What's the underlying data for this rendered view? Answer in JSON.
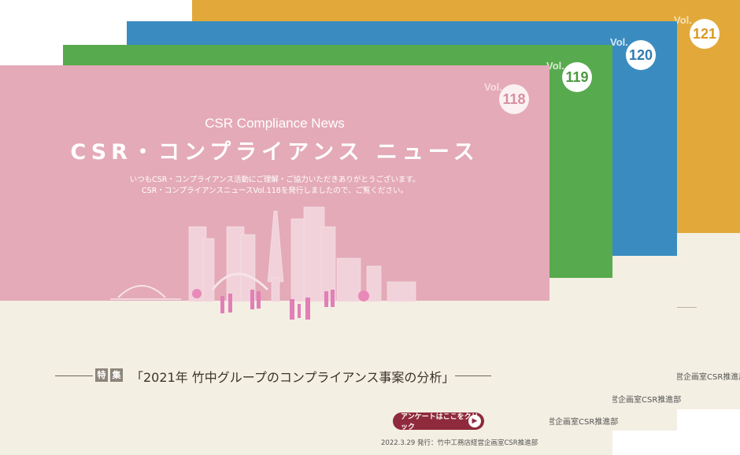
{
  "covers": [
    {
      "vol_label": "Vol.",
      "vol_number": "121",
      "color": "#e2a93a",
      "footer": "営企画室CSR推進部"
    },
    {
      "vol_label": "Vol.",
      "vol_number": "120",
      "color": "#3a8cc0",
      "footer": "営企画室CSR推進部"
    },
    {
      "vol_label": "Vol.",
      "vol_number": "119",
      "color": "#57aa4d",
      "footer": "営企画室CSR推進部"
    },
    {
      "vol_label": "Vol.",
      "vol_number": "118",
      "color": "#e4aab8"
    }
  ],
  "front": {
    "title_en": "CSR Compliance News",
    "title_jp": "CSR・コンプライアンス ニュース",
    "intro_line1": "いつもCSR・コンプライアンス活動にご理解・ご協力いただきありがとうございます。",
    "intro_line2": "CSR・コンプライアンスニュースVol.118を発行しましたので、ご覧ください。",
    "feature_tag_1": "特",
    "feature_tag_2": "集",
    "feature_title": "「2021年 竹中グループのコンプライアンス事案の分析」",
    "survey_button": "アンケートはここをクリック",
    "issue_info": "2022.3.29 発行：竹中工務店経営企画室CSR推進部"
  },
  "colors": {
    "accent_button": "#8f2a3c",
    "cream": "#f4efe3"
  }
}
